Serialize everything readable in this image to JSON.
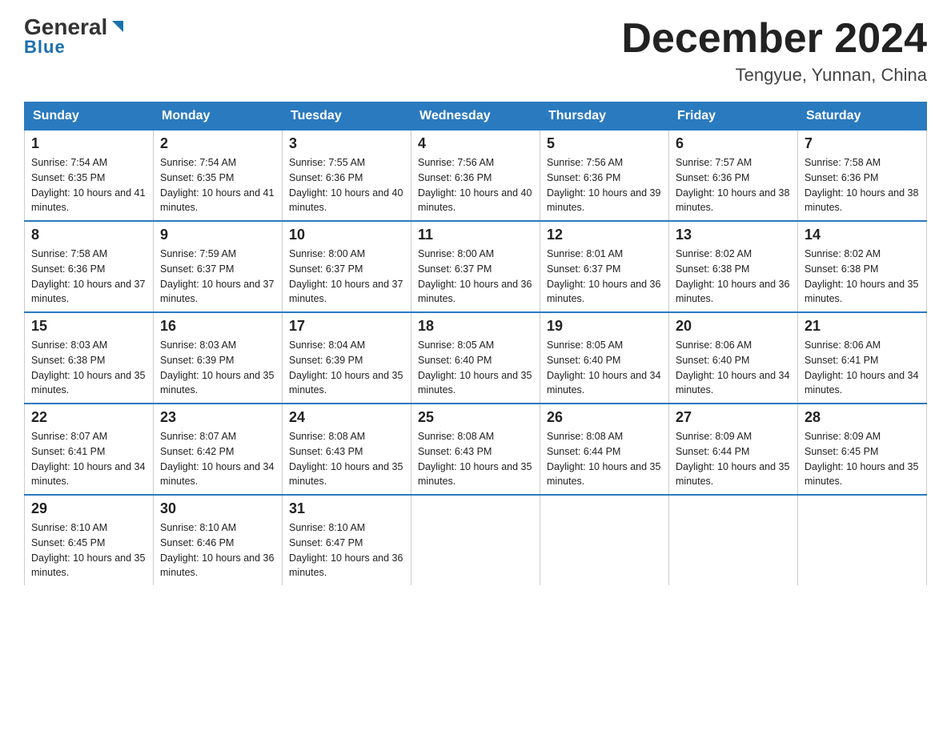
{
  "header": {
    "logo_general": "General",
    "logo_blue": "Blue",
    "month_title": "December 2024",
    "location": "Tengyue, Yunnan, China"
  },
  "days_of_week": [
    "Sunday",
    "Monday",
    "Tuesday",
    "Wednesday",
    "Thursday",
    "Friday",
    "Saturday"
  ],
  "weeks": [
    [
      {
        "day": "1",
        "sunrise": "7:54 AM",
        "sunset": "6:35 PM",
        "daylight": "10 hours and 41 minutes."
      },
      {
        "day": "2",
        "sunrise": "7:54 AM",
        "sunset": "6:35 PM",
        "daylight": "10 hours and 41 minutes."
      },
      {
        "day": "3",
        "sunrise": "7:55 AM",
        "sunset": "6:36 PM",
        "daylight": "10 hours and 40 minutes."
      },
      {
        "day": "4",
        "sunrise": "7:56 AM",
        "sunset": "6:36 PM",
        "daylight": "10 hours and 40 minutes."
      },
      {
        "day": "5",
        "sunrise": "7:56 AM",
        "sunset": "6:36 PM",
        "daylight": "10 hours and 39 minutes."
      },
      {
        "day": "6",
        "sunrise": "7:57 AM",
        "sunset": "6:36 PM",
        "daylight": "10 hours and 38 minutes."
      },
      {
        "day": "7",
        "sunrise": "7:58 AM",
        "sunset": "6:36 PM",
        "daylight": "10 hours and 38 minutes."
      }
    ],
    [
      {
        "day": "8",
        "sunrise": "7:58 AM",
        "sunset": "6:36 PM",
        "daylight": "10 hours and 37 minutes."
      },
      {
        "day": "9",
        "sunrise": "7:59 AM",
        "sunset": "6:37 PM",
        "daylight": "10 hours and 37 minutes."
      },
      {
        "day": "10",
        "sunrise": "8:00 AM",
        "sunset": "6:37 PM",
        "daylight": "10 hours and 37 minutes."
      },
      {
        "day": "11",
        "sunrise": "8:00 AM",
        "sunset": "6:37 PM",
        "daylight": "10 hours and 36 minutes."
      },
      {
        "day": "12",
        "sunrise": "8:01 AM",
        "sunset": "6:37 PM",
        "daylight": "10 hours and 36 minutes."
      },
      {
        "day": "13",
        "sunrise": "8:02 AM",
        "sunset": "6:38 PM",
        "daylight": "10 hours and 36 minutes."
      },
      {
        "day": "14",
        "sunrise": "8:02 AM",
        "sunset": "6:38 PM",
        "daylight": "10 hours and 35 minutes."
      }
    ],
    [
      {
        "day": "15",
        "sunrise": "8:03 AM",
        "sunset": "6:38 PM",
        "daylight": "10 hours and 35 minutes."
      },
      {
        "day": "16",
        "sunrise": "8:03 AM",
        "sunset": "6:39 PM",
        "daylight": "10 hours and 35 minutes."
      },
      {
        "day": "17",
        "sunrise": "8:04 AM",
        "sunset": "6:39 PM",
        "daylight": "10 hours and 35 minutes."
      },
      {
        "day": "18",
        "sunrise": "8:05 AM",
        "sunset": "6:40 PM",
        "daylight": "10 hours and 35 minutes."
      },
      {
        "day": "19",
        "sunrise": "8:05 AM",
        "sunset": "6:40 PM",
        "daylight": "10 hours and 34 minutes."
      },
      {
        "day": "20",
        "sunrise": "8:06 AM",
        "sunset": "6:40 PM",
        "daylight": "10 hours and 34 minutes."
      },
      {
        "day": "21",
        "sunrise": "8:06 AM",
        "sunset": "6:41 PM",
        "daylight": "10 hours and 34 minutes."
      }
    ],
    [
      {
        "day": "22",
        "sunrise": "8:07 AM",
        "sunset": "6:41 PM",
        "daylight": "10 hours and 34 minutes."
      },
      {
        "day": "23",
        "sunrise": "8:07 AM",
        "sunset": "6:42 PM",
        "daylight": "10 hours and 34 minutes."
      },
      {
        "day": "24",
        "sunrise": "8:08 AM",
        "sunset": "6:43 PM",
        "daylight": "10 hours and 35 minutes."
      },
      {
        "day": "25",
        "sunrise": "8:08 AM",
        "sunset": "6:43 PM",
        "daylight": "10 hours and 35 minutes."
      },
      {
        "day": "26",
        "sunrise": "8:08 AM",
        "sunset": "6:44 PM",
        "daylight": "10 hours and 35 minutes."
      },
      {
        "day": "27",
        "sunrise": "8:09 AM",
        "sunset": "6:44 PM",
        "daylight": "10 hours and 35 minutes."
      },
      {
        "day": "28",
        "sunrise": "8:09 AM",
        "sunset": "6:45 PM",
        "daylight": "10 hours and 35 minutes."
      }
    ],
    [
      {
        "day": "29",
        "sunrise": "8:10 AM",
        "sunset": "6:45 PM",
        "daylight": "10 hours and 35 minutes."
      },
      {
        "day": "30",
        "sunrise": "8:10 AM",
        "sunset": "6:46 PM",
        "daylight": "10 hours and 36 minutes."
      },
      {
        "day": "31",
        "sunrise": "8:10 AM",
        "sunset": "6:47 PM",
        "daylight": "10 hours and 36 minutes."
      },
      null,
      null,
      null,
      null
    ]
  ]
}
